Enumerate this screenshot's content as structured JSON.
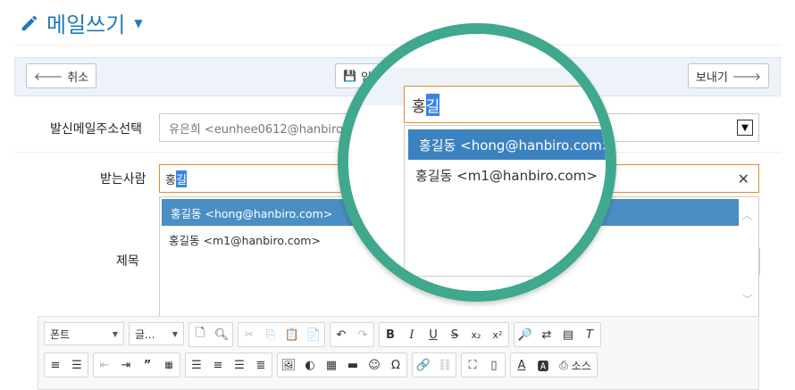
{
  "header": {
    "title": "메일쓰기"
  },
  "toolbar": {
    "cancel_label": "취소",
    "save_label": "임",
    "send_label": "보내기"
  },
  "form": {
    "sender_label": "발신메일주소선택",
    "sender_value": "유은희 <eunhee0612@hanbiro",
    "recipient_label": "받는사람",
    "recipient_typed": "홍",
    "recipient_highlight": "길",
    "subject_label": "제목"
  },
  "suggestions": [
    {
      "label": "홍길동 <hong@hanbiro.com>"
    },
    {
      "label": "홍길동 <m1@hanbiro.com>"
    }
  ],
  "editor": {
    "font_combo": "폰트",
    "size_combo": "글...",
    "source_label": "소스"
  },
  "colors": {
    "brand": "#1f7ab8",
    "accent_ring": "#3fa88f",
    "focus_border": "#e88a2c",
    "selection": "#4a8fc4"
  }
}
